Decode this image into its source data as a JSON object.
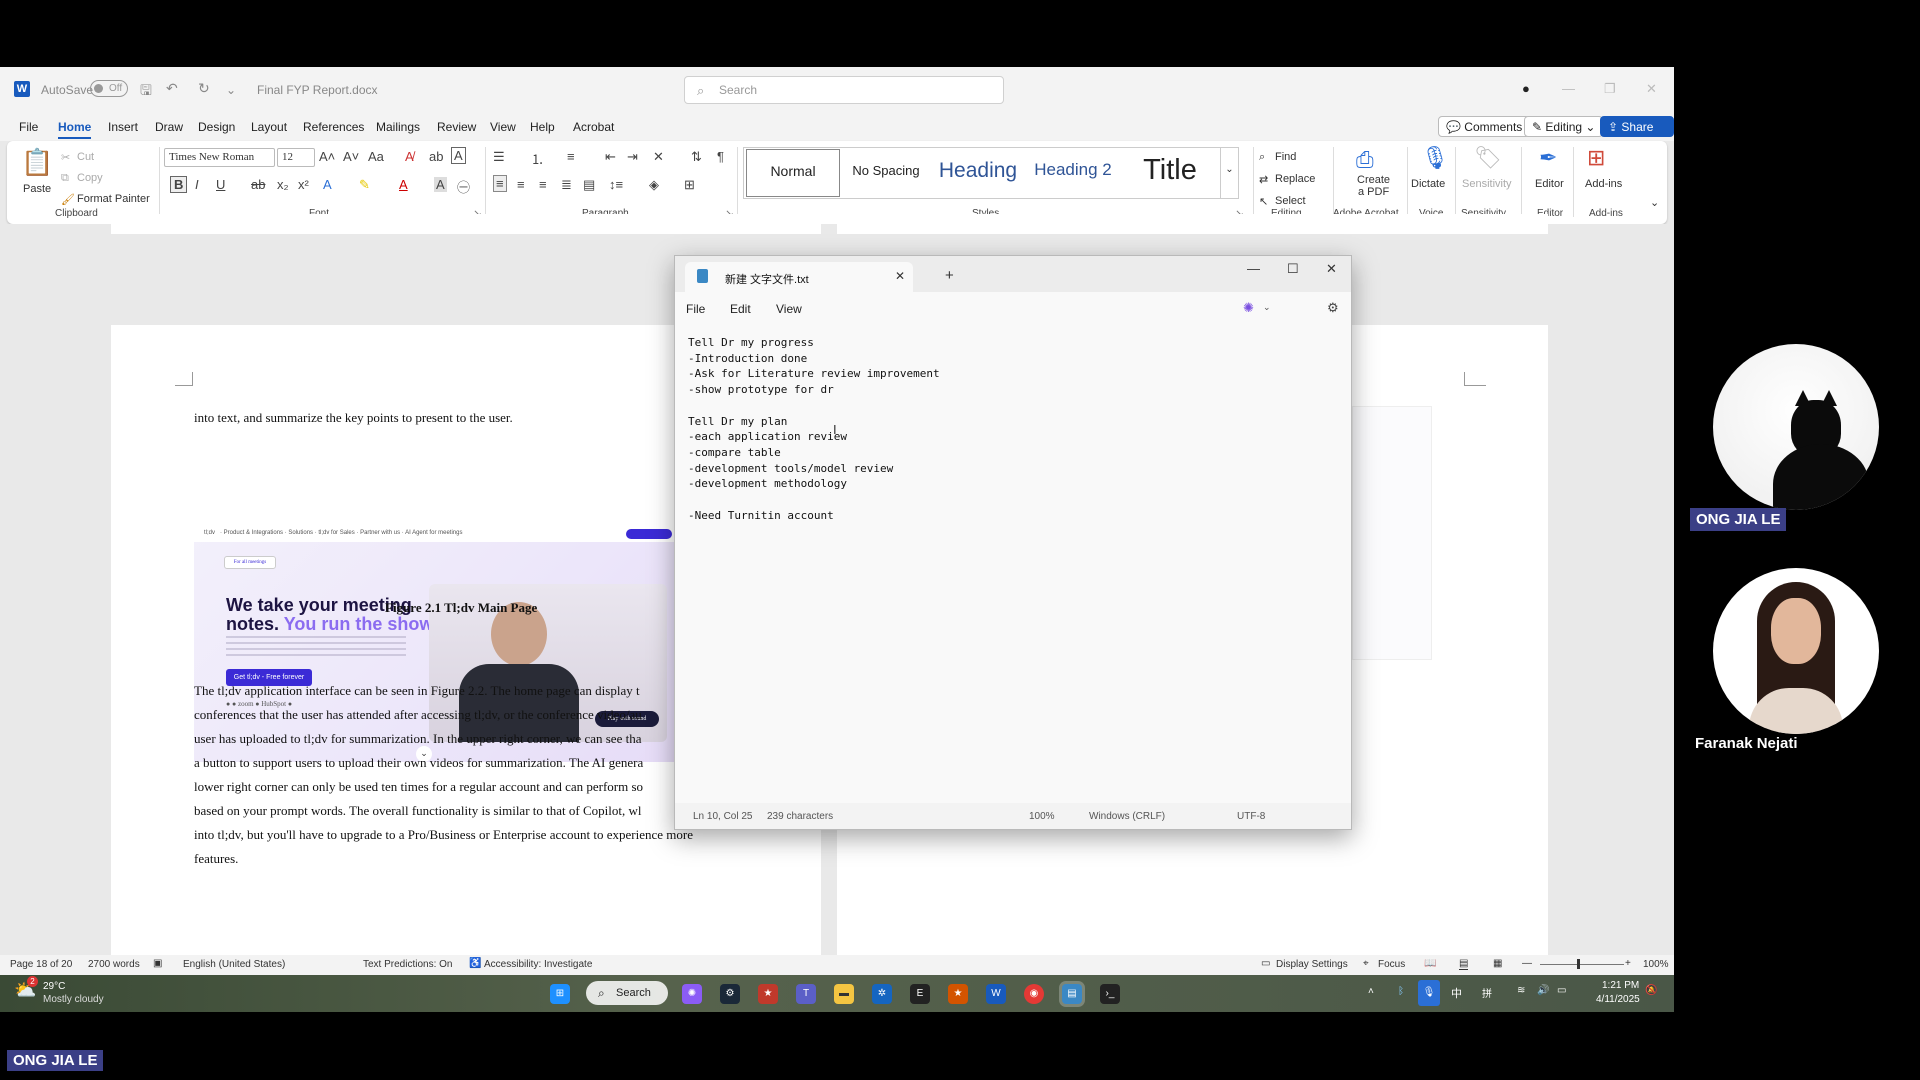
{
  "word": {
    "title_bar": {
      "autosave_label": "AutoSave",
      "autosave_state": "Off",
      "doc_name": "Final FYP Report.docx",
      "search_placeholder": "Search"
    },
    "tabs": [
      "File",
      "Home",
      "Insert",
      "Draw",
      "Design",
      "Layout",
      "References",
      "Mailings",
      "Review",
      "View",
      "Help",
      "Acrobat"
    ],
    "active_tab": "Home",
    "right_buttons": {
      "comments": "Comments",
      "editing": "Editing",
      "share": "Share"
    },
    "ribbon": {
      "clipboard": {
        "paste": "Paste",
        "cut": "Cut",
        "copy": "Copy",
        "format_painter": "Format Painter",
        "label": "Clipboard"
      },
      "font": {
        "name": "Times New Roman",
        "size": "12",
        "label": "Font"
      },
      "paragraph": {
        "label": "Paragraph"
      },
      "styles": {
        "items": [
          "Normal",
          "No Spacing",
          "Heading",
          "Heading 2",
          "Title"
        ],
        "label": "Styles"
      },
      "editing": {
        "find": "Find",
        "replace": "Replace",
        "select": "Select",
        "label": "Editing"
      },
      "acrobat": {
        "create_pdf_line1": "Create",
        "create_pdf_line2": "a PDF",
        "label": "Adobe Acrobat"
      },
      "voice": {
        "dictate": "Dictate",
        "label": "Voice"
      },
      "sensitivity": {
        "sensitivity": "Sensitivity",
        "label": "Sensitivity"
      },
      "editor": {
        "editor": "Editor",
        "label": "Editor"
      },
      "addins": {
        "addins": "Add-ins",
        "label": "Add-ins"
      }
    },
    "document": {
      "line_top": "into text, and summarize the key points to present to the user.",
      "figure_caption": "Figure 2.1 Tl;dv Main Page",
      "para_lines": [
        "The tl;dv application interface can be seen in Figure 2.2. The home page can display t",
        "conferences that the user has attended after accessing tl;dv, or the conference video/au",
        "user has uploaded to tl;dv for summarization. In the upper right corner, we can see tha",
        "a button to support users to upload their own videos for summarization. The AI genera",
        "lower right corner can only be used ten times for a regular account and can perform so",
        "based on your prompt words. The overall functionality is similar to that of Copilot, wl",
        "into tl;dv, but you'll have to upgrade to a Pro/Business or Enterprise account to experience more",
        "features."
      ],
      "tldv": {
        "headline_1": "We take your meeting",
        "headline_2": "notes.",
        "headline_3": "You run the show.",
        "cta": "Get tl;dv - Free forever",
        "play_btn": "Play with sound"
      }
    },
    "status_bar": {
      "page": "Page 18 of 20",
      "words": "2700 words",
      "language": "English (United States)",
      "predictions": "Text Predictions: On",
      "accessibility": "Accessibility: Investigate",
      "display_settings": "Display Settings",
      "focus": "Focus",
      "zoom": "100%"
    }
  },
  "notepad": {
    "tab_title": "新建 文字文件.txt",
    "menu": [
      "File",
      "Edit",
      "View"
    ],
    "text": "Tell Dr my progress\n-Introduction done\n-Ask for Literature review improvement\n-show prototype for dr\n\nTell Dr my plan\n-each application review\n-compare table\n-development tools/model review\n-development methodology\n\n-Need Turnitin account",
    "status": {
      "position": "Ln 10, Col 25",
      "chars": "239 characters",
      "zoom": "100%",
      "line_ending": "Windows (CRLF)",
      "encoding": "UTF-8"
    }
  },
  "taskbar": {
    "weather_temp": "29°C",
    "weather_desc": "Mostly cloudy",
    "weather_badge": "2",
    "search": "Search",
    "time": "1:21 PM",
    "date": "4/11/2025",
    "ime": "中"
  },
  "participants": [
    {
      "name": "ONG JIA LE"
    },
    {
      "name": "Faranak Nejati"
    }
  ],
  "presenter_tag": "ONG JIA LE"
}
